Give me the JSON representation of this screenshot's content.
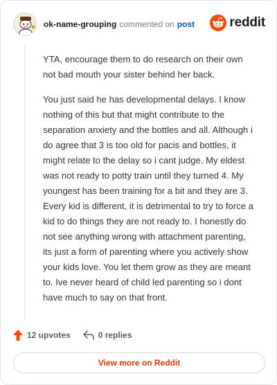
{
  "header": {
    "username": "ok-name-grouping",
    "action_text": "commented on",
    "post_link": "post",
    "brand_name": "reddit",
    "brand_color": "#ff4500",
    "avatar_icon": "snoo-avatar-icon"
  },
  "comment": {
    "paragraphs": [
      "YTA, encourage them to do research on their own not bad mouth your sister behind her back.",
      "You just said he has developmental delays. I know nothing of this but that might contribute to the separation anxiety and the bottles and all. Although i do agree that 3 is too old for pacis and bottles, it might relate to the delay so i cant judge. My eldest was not ready to potty train until they turned 4. My youngest has been training for a bit and they are 3. Every kid is different, it is detrimental to try to force a kid to do things they are not ready to. I honestly do not see anything wrong with attachment parenting, its just a form of parenting where you actively show your kids love. You let them grow as they are meant to. Ive never heard of child led parenting so i dont have much to say on that front."
    ]
  },
  "actions": {
    "upvotes_label": "12 upvotes",
    "replies_label": "0 replies",
    "upvote_icon": "upvote-arrow-icon",
    "reply_icon": "reply-arrow-icon",
    "upvote_color": "#ff4500"
  },
  "footer": {
    "view_more_label": "View more on Reddit"
  }
}
